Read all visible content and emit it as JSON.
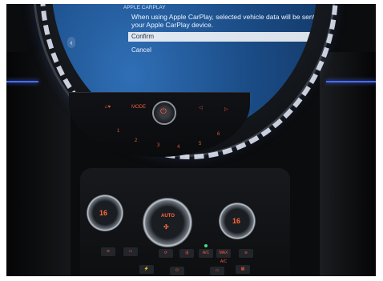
{
  "carplay_dialog": {
    "header": "APPLE CARPLAY",
    "message": "When using Apple CarPlay, selected vehicle data will be sent to your Apple CarPlay device.",
    "confirm_label": "Confirm",
    "cancel_label": "Cancel"
  },
  "control_strip": {
    "mode_label": "MODE",
    "presets": [
      "1",
      "2",
      "3",
      "4",
      "5",
      "6"
    ]
  },
  "climate": {
    "left_temp": "16",
    "right_temp": "16",
    "auto_label": "AUTO",
    "ac_label": "A/C",
    "max_ac_label": "MAX A/C"
  },
  "colors": {
    "accent_red": "#ff5a3a",
    "screen_blue": "#1b4c86",
    "ambient_blue": "#4a6dff"
  }
}
